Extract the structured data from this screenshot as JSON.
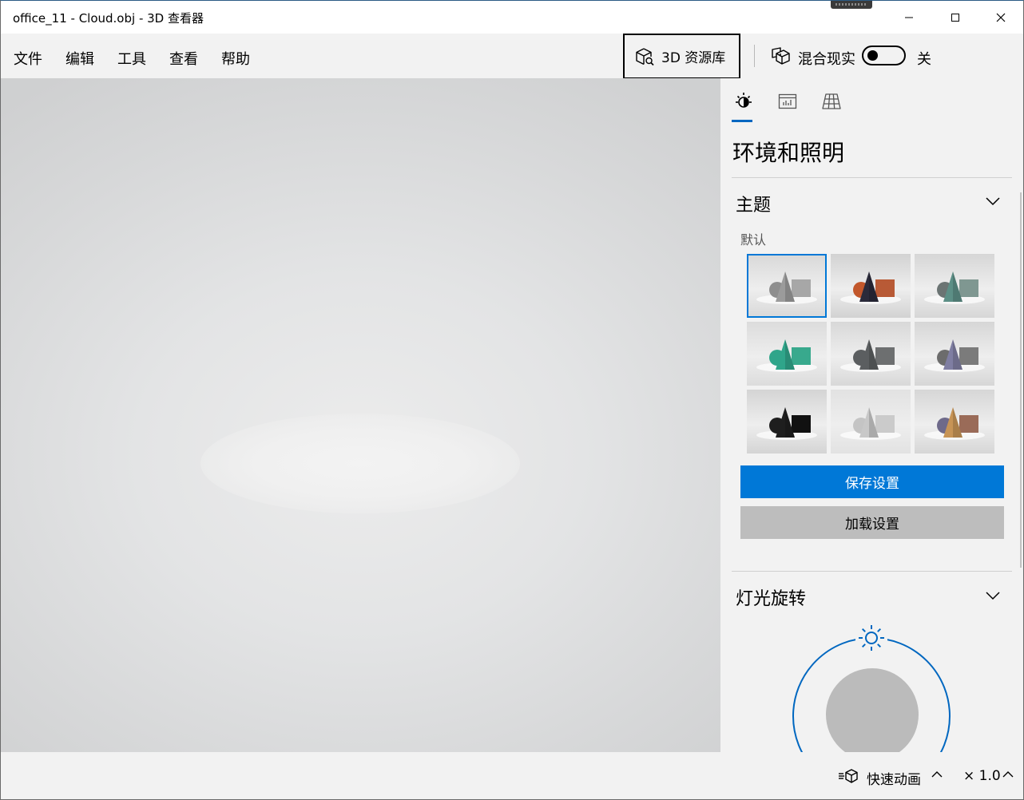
{
  "window": {
    "title": "office_11 - Cloud.obj - 3D 查看器"
  },
  "menu": {
    "items": [
      "文件",
      "编辑",
      "工具",
      "查看",
      "帮助"
    ],
    "library_button": "3D 资源库",
    "mixed_reality_label": "混合现实",
    "mixed_reality_state": "关"
  },
  "panel": {
    "active_tab": "environment-and-lighting",
    "title": "环境和照明",
    "theme_section": {
      "heading": "主题",
      "subheading": "默认",
      "selected_index": 0,
      "themes": [
        {
          "cone": "#9b9b9b",
          "sphere": "#8e8e8e",
          "box": "#a7a7a7",
          "bg": "#d8d8d8"
        },
        {
          "cone": "#2a2a3a",
          "sphere": "#c2572b",
          "box": "#b85a36",
          "bg": "#d2d2d2"
        },
        {
          "cone": "#5c8f86",
          "sphere": "#6b7473",
          "box": "#7f9791",
          "bg": "#d6d6d6"
        },
        {
          "cone": "#2fa58a",
          "sphere": "#2fa58a",
          "box": "#38a98d",
          "bg": "#dcdcdc"
        },
        {
          "cone": "#5b5e60",
          "sphere": "#5b5e60",
          "box": "#6d6f70",
          "bg": "#d8d8d8"
        },
        {
          "cone": "#7f7ea2",
          "sphere": "#6c6c6c",
          "box": "#7b7b7b",
          "bg": "#d6d6d6"
        },
        {
          "cone": "#1e1e1e",
          "sphere": "#1e1e1e",
          "box": "#111111",
          "bg": "#d4d4d4"
        },
        {
          "cone": "#c8c8c8",
          "sphere": "#c4c4c4",
          "box": "#cbcbcb",
          "bg": "#e2e2e2"
        },
        {
          "cone": "#c79456",
          "sphere": "#6e6a8a",
          "box": "#9a6b58",
          "bg": "#d6d6d6"
        }
      ],
      "save_button": "保存设置",
      "load_button": "加载设置"
    },
    "light_section": {
      "heading": "灯光旋转"
    }
  },
  "statusbar": {
    "animation_label": "快速动画",
    "speed_label": "× 1.0"
  },
  "colors": {
    "accent": "#0078d7",
    "panel_bg": "#f2f2f2",
    "viewport_bg": "#dcdddd"
  }
}
